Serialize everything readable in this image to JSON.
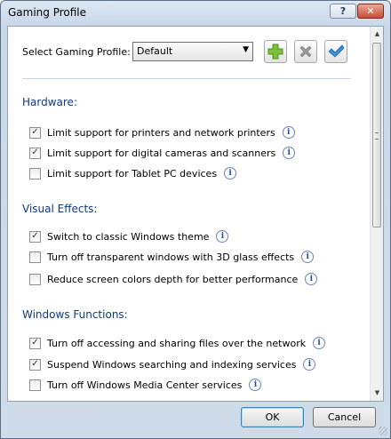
{
  "window": {
    "title": "Gaming Profile",
    "help_glyph": "?",
    "close_glyph": "✕"
  },
  "profile": {
    "label": "Select Gaming Profile:",
    "selected": "Default"
  },
  "sections": [
    {
      "title": "Hardware:",
      "items": [
        {
          "label": "Limit support for printers and network printers",
          "checked": true
        },
        {
          "label": "Limit support for digital cameras and scanners",
          "checked": true
        },
        {
          "label": "Limit support for Tablet PC devices",
          "checked": false
        }
      ]
    },
    {
      "title": "Visual Effects:",
      "items": [
        {
          "label": "Switch to classic Windows theme",
          "checked": true
        },
        {
          "label": "Turn off transparent windows with 3D glass effects",
          "checked": false
        },
        {
          "label": "Reduce screen colors depth for better performance",
          "checked": false
        }
      ]
    },
    {
      "title": "Windows Functions:",
      "items": [
        {
          "label": "Turn off accessing and sharing files over the network",
          "checked": true
        },
        {
          "label": "Suspend Windows searching and indexing services",
          "checked": true
        },
        {
          "label": "Turn off Windows Media Center services",
          "checked": false
        }
      ]
    }
  ],
  "buttons": {
    "ok": "OK",
    "cancel": "Cancel"
  },
  "icons": {
    "add": "plus-icon",
    "delete": "x-icon",
    "apply": "checkmark-icon",
    "info": "info-icon"
  },
  "colors": {
    "section_title": "#0e3a86",
    "add_green": "#7bbf3a",
    "apply_blue": "#3b8fd6",
    "delete_gray": "#9a9a9a"
  }
}
